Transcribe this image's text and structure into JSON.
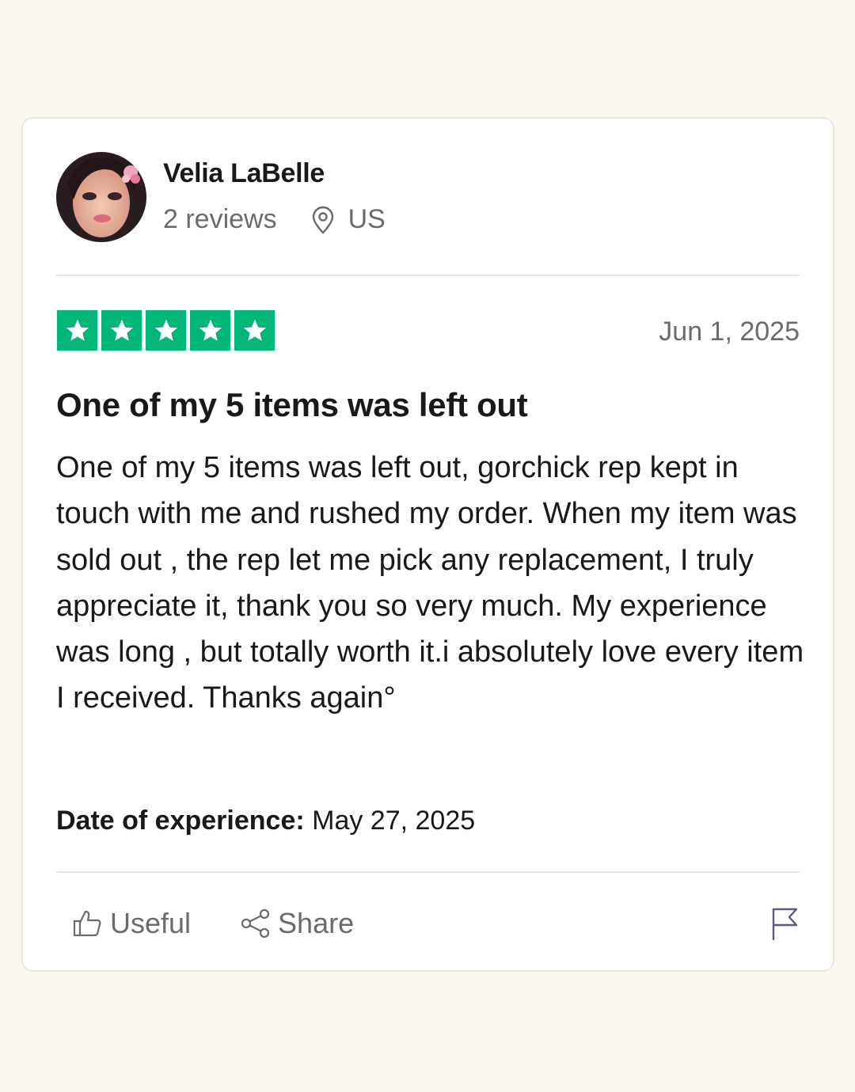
{
  "reviewer": {
    "name": "Velia LaBelle",
    "reviews_count": "2 reviews",
    "location": "US",
    "avatar_icon": "profile-photo"
  },
  "review": {
    "rating": 5,
    "rating_max": 5,
    "date": "Jun 1, 2025",
    "title": "One of my 5 items was left out",
    "body": "One of my 5 items was left out, gorchick rep kept in touch with me and rushed my order. When my item was sold out , the rep let me pick any replacement, I truly appreciate it, thank you so very much. My experience was long , but totally worth it.i absolutely love every item I received. Thanks again°",
    "experience_label": "Date of experience:",
    "experience_date": "May 27, 2025"
  },
  "actions": {
    "useful_label": "Useful",
    "share_label": "Share",
    "useful_icon": "thumbs-up-icon",
    "share_icon": "share-icon",
    "flag_icon": "flag-icon"
  },
  "colors": {
    "star_green": "#00b67a",
    "page_background": "#faf8f1",
    "card_background": "#ffffff",
    "muted_text": "#6b6b6b"
  }
}
